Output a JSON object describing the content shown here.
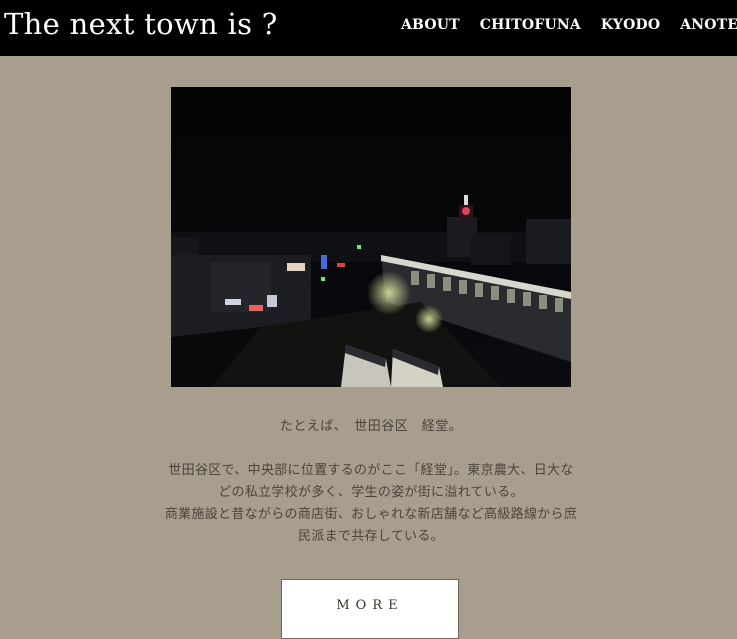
{
  "header": {
    "title": "The next town is ?",
    "nav": [
      "ABOUT",
      "CHITOFUNA",
      "KYODO",
      "ANOTEHR"
    ]
  },
  "main": {
    "lead": "たとえば、　世田谷区　経堂。",
    "description_lines": [
      "世田谷区で、中央部に位置するのがここ「経堂」。東京農大、日大な",
      "どの私立学校が多く、学生の姿が街に溢れている。",
      "商業施設と昔ながらの商店街、おしゃれな新店舗など高級路線から庶",
      "民派まで共存している。"
    ],
    "more_label": "MORE"
  },
  "colors": {
    "header_bg": "#000000",
    "page_bg": "#a89e8d",
    "text": "#4c443a",
    "button_bg": "#ffffff"
  }
}
